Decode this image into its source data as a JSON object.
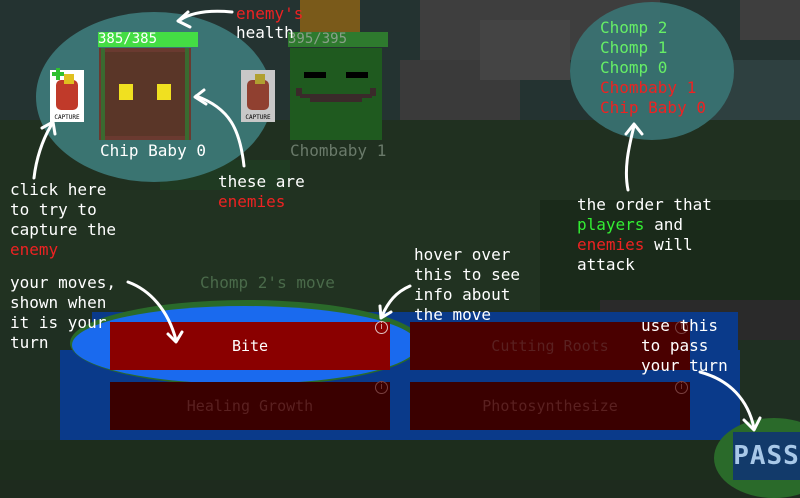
{
  "annotations": {
    "enemy_health_1": "enemy's",
    "enemy_health_2": "health",
    "capture_1": "click here",
    "capture_2": "to try to",
    "capture_3": "capture the",
    "capture_4": "enemy",
    "enemies_1": "these are",
    "enemies_2": "enemies",
    "order_1": "the order that",
    "order_2a": "players",
    "order_2b": " and",
    "order_3a": "enemies",
    "order_3b": " will",
    "order_4": "attack",
    "moves_1": "your moves,",
    "moves_2": "shown when",
    "moves_3": "it is your",
    "moves_4": "turn",
    "hover_1": "hover over",
    "hover_2": "this to see",
    "hover_3": "info about",
    "hover_4": "the move",
    "pass_1": "use this",
    "pass_2": "to pass",
    "pass_3": "your turn"
  },
  "enemies": [
    {
      "name": "Chip Baby 0",
      "health": "385/385",
      "health_fraction": 1.0
    },
    {
      "name": "Chombaby 1",
      "health": "395/395",
      "health_fraction": 1.0
    }
  ],
  "capture_label": "CAPTURE",
  "turn_order": [
    {
      "name": "Chomp 2",
      "side": "player"
    },
    {
      "name": "Chomp 1",
      "side": "player"
    },
    {
      "name": "Chomp 0",
      "side": "player"
    },
    {
      "name": "Chombaby 1",
      "side": "enemy"
    },
    {
      "name": "Chip Baby 0",
      "side": "enemy"
    }
  ],
  "move_header": "Chomp 2's move",
  "moves": [
    "Bite",
    "Cutting Roots",
    "Healing Growth",
    "Photosynthesize"
  ],
  "info_glyph": "i",
  "pass_label": "PASS",
  "colors": {
    "player": "#66ee66",
    "enemy": "#ee2222",
    "health_bar": "#44dd44",
    "highlight_teal": "#3a7a7a",
    "highlight_blue": "#1a6aee",
    "move_button": "#5a0000",
    "annotation_text": "#ffffff"
  }
}
